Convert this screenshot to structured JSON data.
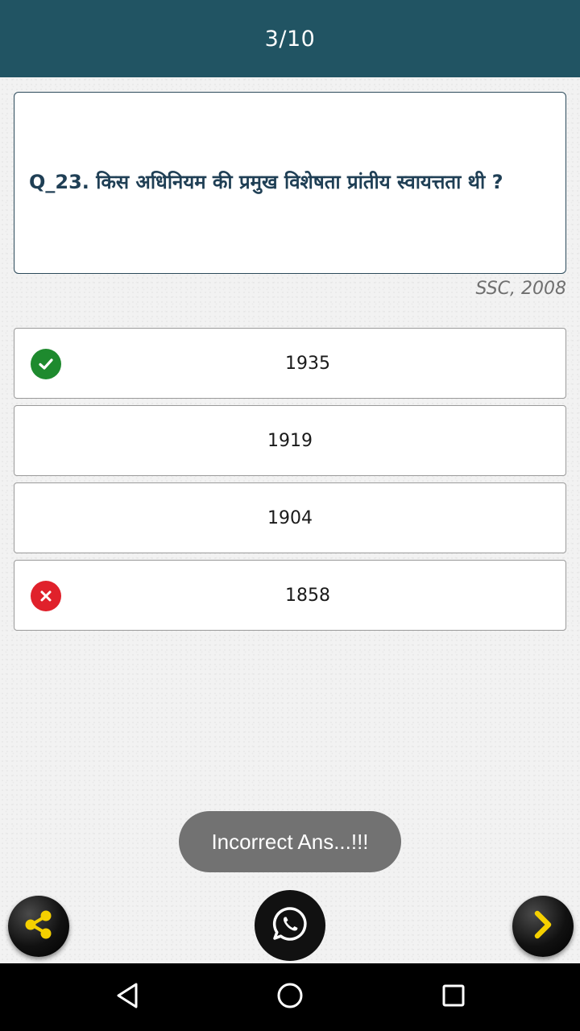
{
  "header": {
    "progress": "3/10"
  },
  "question": {
    "text": "Q_23. किस अधिनियम की प्रमुख विशेषता प्रांतीय स्वायत्तता थी ?",
    "source": "SSC, 2008"
  },
  "options": [
    {
      "label": "1935",
      "status": "correct",
      "icon": "check-icon"
    },
    {
      "label": "1919",
      "status": "none"
    },
    {
      "label": "1904",
      "status": "none"
    },
    {
      "label": "1858",
      "status": "wrong",
      "icon": "close-icon"
    }
  ],
  "toast": {
    "text": "Incorrect Ans...!!!"
  },
  "actions": {
    "share_icon": "share-icon",
    "whatsapp_icon": "whatsapp-icon",
    "next_icon": "chevron-right-icon"
  },
  "colors": {
    "header": "#215463",
    "question_text": "#1f3f55",
    "correct": "#1e8a2e",
    "wrong": "#e0212b",
    "accent_yellow": "#f5d000"
  }
}
